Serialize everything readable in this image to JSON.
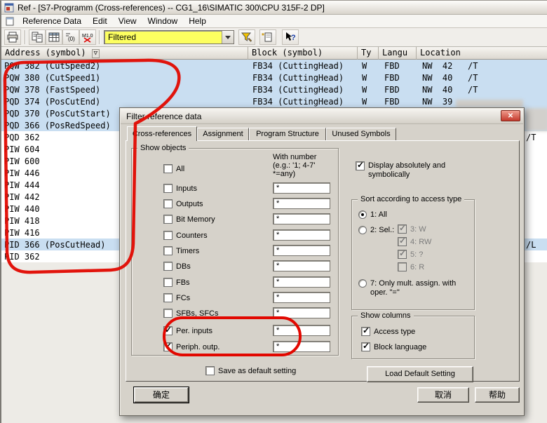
{
  "window": {
    "title": "Ref - [S7-Programm (Cross-references) -- CG1_16\\SIMATIC 300\\CPU 315F-2 DP]",
    "menu": [
      "Reference Data",
      "Edit",
      "View",
      "Window",
      "Help"
    ],
    "toolbar": {
      "filter_value": "Filtered",
      "list_icon_label": "(0)",
      "symbol_icon_label": "M1.0",
      "help_icon_label": "?"
    }
  },
  "table": {
    "sort_indicator": "▽",
    "columns": [
      "Address (symbol)",
      "Block (symbol)",
      "Ty",
      "Langu",
      "Location"
    ],
    "rows": [
      {
        "address": "PQW 382 (CutSpeed2)",
        "block": "FB34 (CuttingHead)",
        "ty": "W",
        "lang": "FBD",
        "loc": "NW  42   /T",
        "tail": "",
        "hl": true
      },
      {
        "address": "PQW 380 (CutSpeed1)",
        "block": "FB34 (CuttingHead)",
        "ty": "W",
        "lang": "FBD",
        "loc": "NW  40   /T",
        "tail": "",
        "hl": true
      },
      {
        "address": "PQW 378 (FastSpeed)",
        "block": "FB34 (CuttingHead)",
        "ty": "W",
        "lang": "FBD",
        "loc": "NW  40   /T",
        "tail": "",
        "hl": true
      },
      {
        "address": "PQD 374 (PosCutEnd)",
        "block": "FB34 (CuttingHead)",
        "ty": "W",
        "lang": "FBD",
        "loc": "NW  39",
        "tail": "",
        "hl": true
      },
      {
        "address": "PQD 370 (PosCutStart)",
        "block": "",
        "ty": "",
        "lang": "",
        "loc": "",
        "tail": "",
        "hl": true
      },
      {
        "address": "PQD 366 (PosRedSpeed)",
        "block": "",
        "ty": "",
        "lang": "",
        "loc": "",
        "tail": "",
        "hl": true
      },
      {
        "address": "PQD 362",
        "block": "",
        "ty": "",
        "lang": "",
        "loc": "",
        "tail": "/T",
        "hl": false
      },
      {
        "address": "PIW 604",
        "block": "",
        "ty": "",
        "lang": "",
        "loc": "",
        "tail": "",
        "hl": false
      },
      {
        "address": "PIW 600",
        "block": "",
        "ty": "",
        "lang": "",
        "loc": "",
        "tail": "",
        "hl": false
      },
      {
        "address": "PIW 446",
        "block": "",
        "ty": "",
        "lang": "",
        "loc": "",
        "tail": "",
        "hl": false
      },
      {
        "address": "PIW 444",
        "block": "",
        "ty": "",
        "lang": "",
        "loc": "",
        "tail": "",
        "hl": false
      },
      {
        "address": "PIW 442",
        "block": "",
        "ty": "",
        "lang": "",
        "loc": "",
        "tail": "",
        "hl": false
      },
      {
        "address": "PIW 440",
        "block": "",
        "ty": "",
        "lang": "",
        "loc": "",
        "tail": "",
        "hl": false
      },
      {
        "address": "PIW 418",
        "block": "",
        "ty": "",
        "lang": "",
        "loc": "",
        "tail": "",
        "hl": false
      },
      {
        "address": "PIW 416",
        "block": "",
        "ty": "",
        "lang": "",
        "loc": "",
        "tail": "",
        "hl": false
      },
      {
        "address": "PID 366 (PosCutHead)",
        "block": "",
        "ty": "",
        "lang": "",
        "loc": "",
        "tail": "/L",
        "hl": true
      },
      {
        "address": "PID 362",
        "block": "",
        "ty": "",
        "lang": "",
        "loc": "",
        "tail": "",
        "hl": false
      }
    ]
  },
  "dialog": {
    "title": "Filter reference data",
    "tabs": [
      "Cross-references",
      "Assignment",
      "Program Structure",
      "Unused Symbols"
    ],
    "active_tab_index": 0,
    "show_objects": {
      "legend": "Show objects",
      "with_number_header": "With number (e.g.: '1; 4-7' *=any)",
      "items": [
        {
          "label": "All",
          "checked": false
        },
        {
          "label": "Inputs",
          "checked": false,
          "value": "*"
        },
        {
          "label": "Outputs",
          "checked": false,
          "value": "*"
        },
        {
          "label": "Bit Memory",
          "checked": false,
          "value": "*"
        },
        {
          "label": "Counters",
          "checked": false,
          "value": "*"
        },
        {
          "label": "Timers",
          "checked": false,
          "value": "*"
        },
        {
          "label": "DBs",
          "checked": false,
          "value": "*"
        },
        {
          "label": "FBs",
          "checked": false,
          "value": "*"
        },
        {
          "label": "FCs",
          "checked": false,
          "value": "*"
        },
        {
          "label": "SFBs, SFCs",
          "checked": false,
          "value": "*"
        },
        {
          "label": "Per. inputs",
          "checked": true,
          "value": "*"
        },
        {
          "label": "Periph. outp.",
          "checked": true,
          "value": "*"
        }
      ]
    },
    "save_default": {
      "label": "Save as default setting",
      "checked": false
    },
    "display_option": {
      "label": "Display absolutely and symbolically",
      "checked": true
    },
    "sort_group": {
      "legend": "Sort according to access type",
      "radio_all": {
        "label": "1: All",
        "selected": true
      },
      "radio_sel": {
        "label": "2: Sel.:",
        "selected": false
      },
      "radio_mult": {
        "label": "7: Only mult. assign. with oper. \"=\"",
        "selected": false
      },
      "sel_options": [
        {
          "label": "3: W",
          "checked": true,
          "disabled": true
        },
        {
          "label": "4: RW",
          "checked": true,
          "disabled": true
        },
        {
          "label": "5: ?",
          "checked": true,
          "disabled": true
        },
        {
          "label": "6: R",
          "checked": false,
          "disabled": true
        }
      ]
    },
    "show_columns": {
      "legend": "Show columns",
      "items": [
        {
          "label": "Access type",
          "checked": true
        },
        {
          "label": "Block language",
          "checked": true
        }
      ]
    },
    "load_default_label": "Load Default Setting",
    "buttons": {
      "ok": "确定",
      "cancel": "取消",
      "help": "帮助"
    }
  },
  "colors": {
    "annotation": "#e20800",
    "row_highlight": "#c9def1",
    "filter_combo_bg": "#fdff60"
  }
}
